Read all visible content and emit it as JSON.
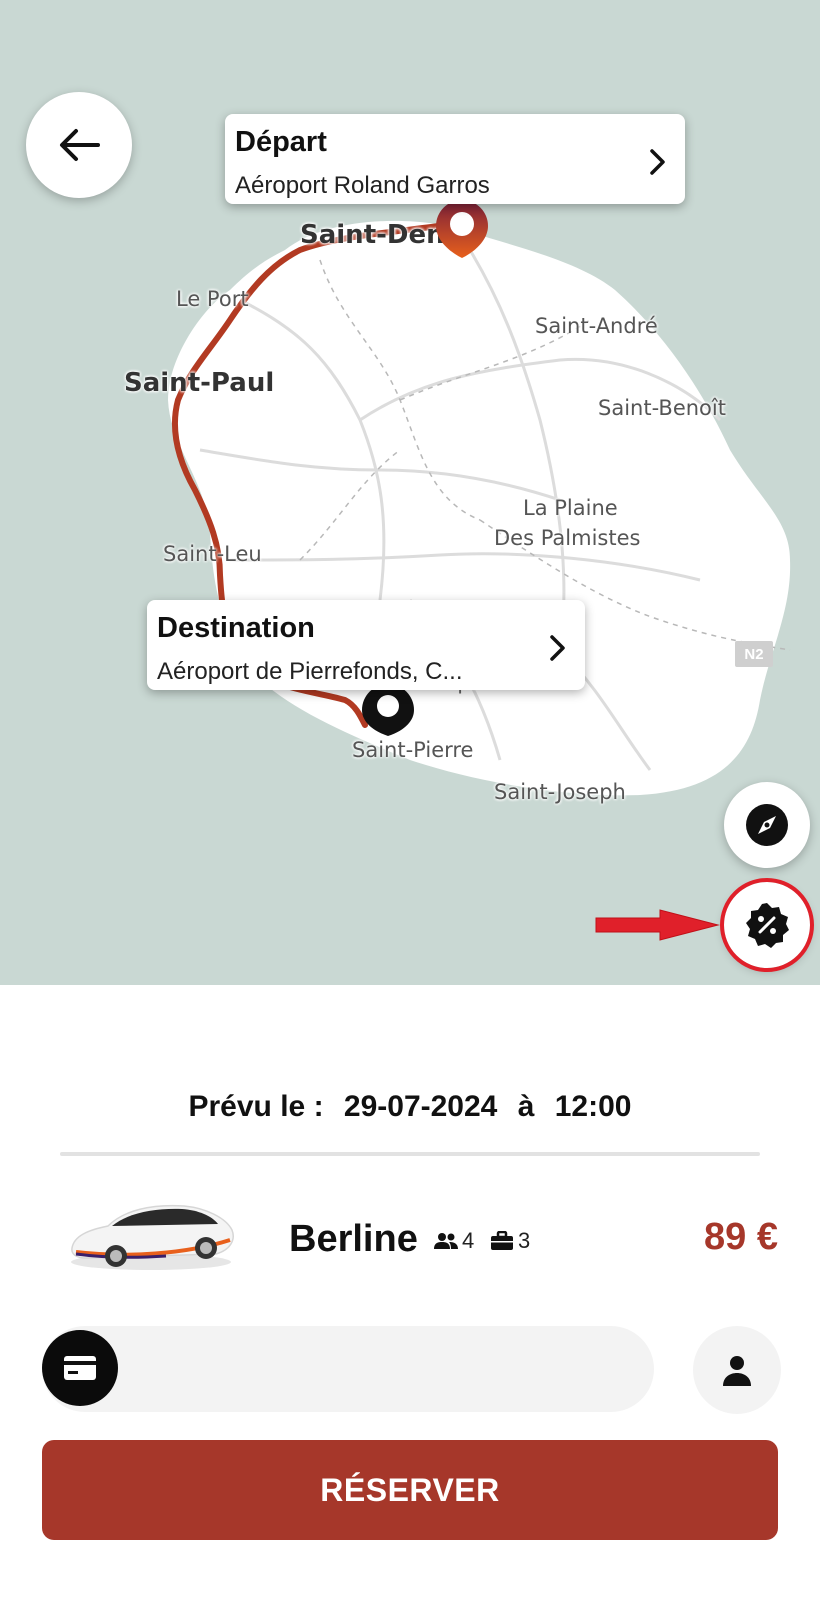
{
  "map": {
    "labels": {
      "saint_denis": "Saint-Den",
      "le_port": "Le Port",
      "saint_paul": "Saint-Paul",
      "saint_andre": "Saint-André",
      "saint_benoit": "Saint-Benoît",
      "la_plaine": "La Plaine",
      "des_palmistes": "Des Palmistes",
      "saint_leu": "Saint-Leu",
      "le_tampon": "e Tampon",
      "saint_pierre": "Saint-Pierre",
      "saint_joseph": "Saint-Joseph",
      "road_n2": "N2"
    },
    "route_color": "#b23a22"
  },
  "departure": {
    "title": "Départ",
    "value": "Aéroport Roland Garros"
  },
  "destination": {
    "title": "Destination",
    "value": "Aéroport de Pierrefonds, C..."
  },
  "buttons": {
    "back_icon": "arrow-left-icon",
    "locate_icon": "compass-icon",
    "promo_icon": "percent-badge-icon"
  },
  "schedule": {
    "label": "Prévu le :",
    "date": "29-07-2024",
    "at": "à",
    "time": "12:00"
  },
  "vehicle": {
    "name": "Berline",
    "passengers": "4",
    "luggage": "3",
    "price": "89 €"
  },
  "payment": {
    "icon": "credit-card-icon",
    "value": ""
  },
  "reserve_label": "RÉSERVER",
  "colors": {
    "accent": "#a6372a",
    "map_water": "#c9d8d3",
    "annotation": "#e0202a"
  }
}
